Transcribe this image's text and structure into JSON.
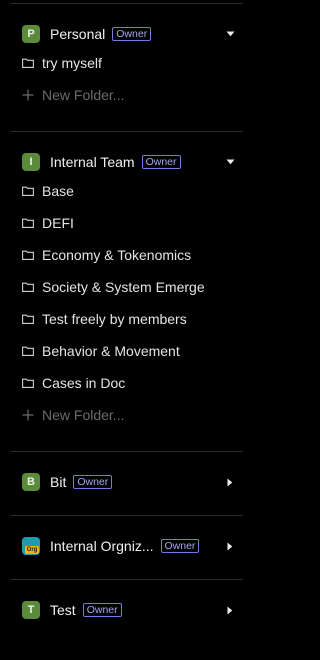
{
  "workspaces": [
    {
      "avatar": "P",
      "name": "Personal",
      "badge": "Owner",
      "expanded": true,
      "folders": [
        "try myself"
      ],
      "new_folder_label": "New Folder..."
    },
    {
      "avatar": "I",
      "name": "Internal Team",
      "badge": "Owner",
      "expanded": true,
      "folders": [
        "Base",
        "DEFI",
        "Economy & Tokenomics",
        "Society & System Emerge",
        "Test freely by members",
        "Behavior & Movement",
        "Cases in Doc"
      ],
      "new_folder_label": "New Folder..."
    },
    {
      "avatar": "B",
      "name": "Bit",
      "badge": "Owner",
      "expanded": false
    },
    {
      "avatar_tag": "Org",
      "name": "Internal Orgniz...",
      "badge": "Owner",
      "expanded": false
    },
    {
      "avatar": "T",
      "name": "Test",
      "badge": "Owner",
      "expanded": false
    }
  ],
  "colors": {
    "background": "#000000",
    "avatar_green": "#5a8a3a",
    "badge_accent": "#7a77e0"
  },
  "icons": {
    "expanded": "caret-down-icon",
    "collapsed": "caret-right-icon",
    "folder": "folder-icon",
    "add": "plus-icon"
  }
}
